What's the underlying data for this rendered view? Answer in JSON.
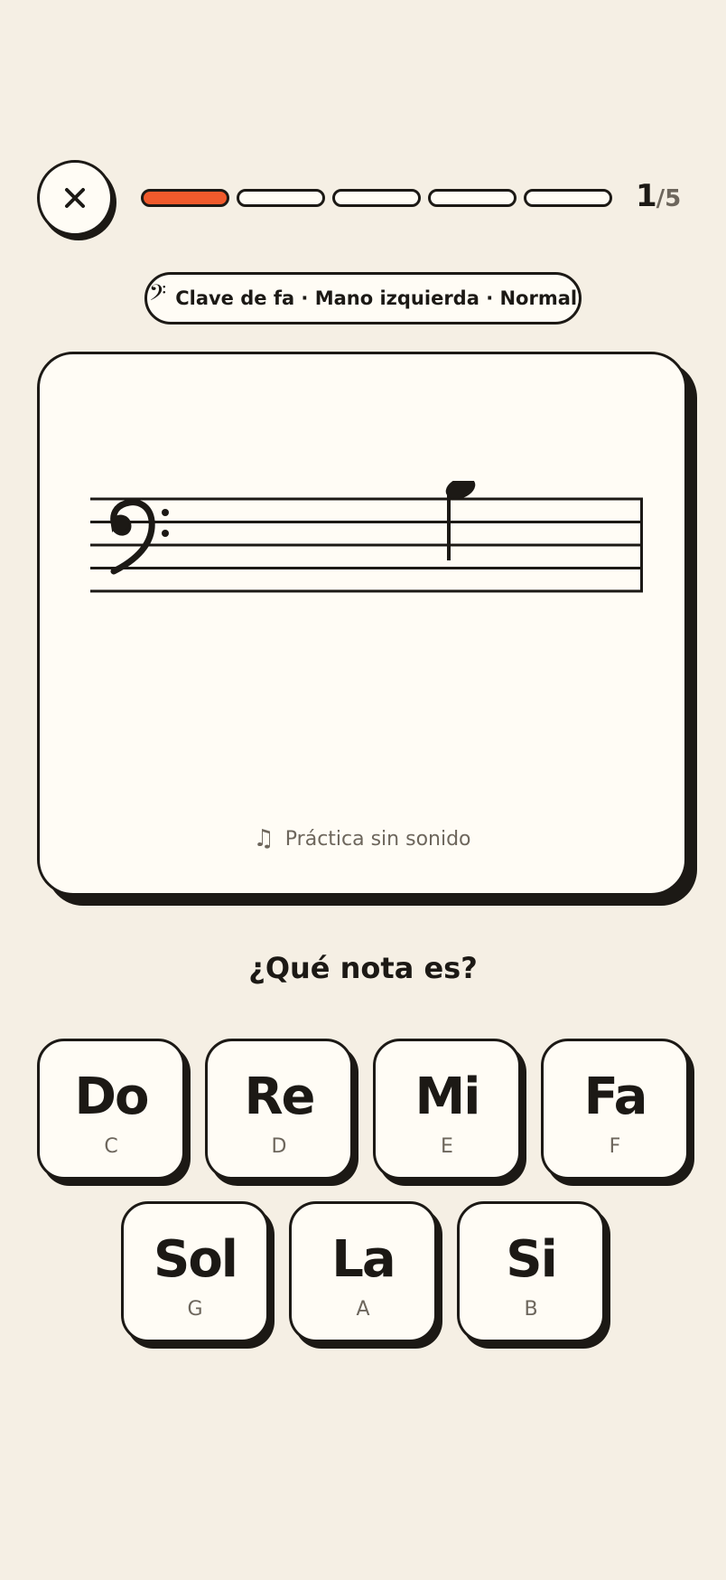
{
  "header": {
    "close_icon": "close-icon",
    "progress": {
      "current": 1,
      "total": 5
    },
    "counter_current": "1",
    "counter_total": "/5",
    "accent_color": "#f05a2c"
  },
  "mode_pill": {
    "icon": "bass-clef-icon",
    "glyph": "𝄢",
    "label": "Clave de fa · Mano izquierda · Normal"
  },
  "exercise": {
    "clef": "bass",
    "note": "quarter-note",
    "silent_icon": "music-note-icon",
    "silent_glyph": "♫",
    "silent_label": "Práctica sin sonido"
  },
  "question": "¿Qué nota es?",
  "answers": [
    {
      "name": "Do",
      "letter": "C"
    },
    {
      "name": "Re",
      "letter": "D"
    },
    {
      "name": "Mi",
      "letter": "E"
    },
    {
      "name": "Fa",
      "letter": "F"
    },
    {
      "name": "Sol",
      "letter": "G"
    },
    {
      "name": "La",
      "letter": "A"
    },
    {
      "name": "Si",
      "letter": "B"
    }
  ]
}
